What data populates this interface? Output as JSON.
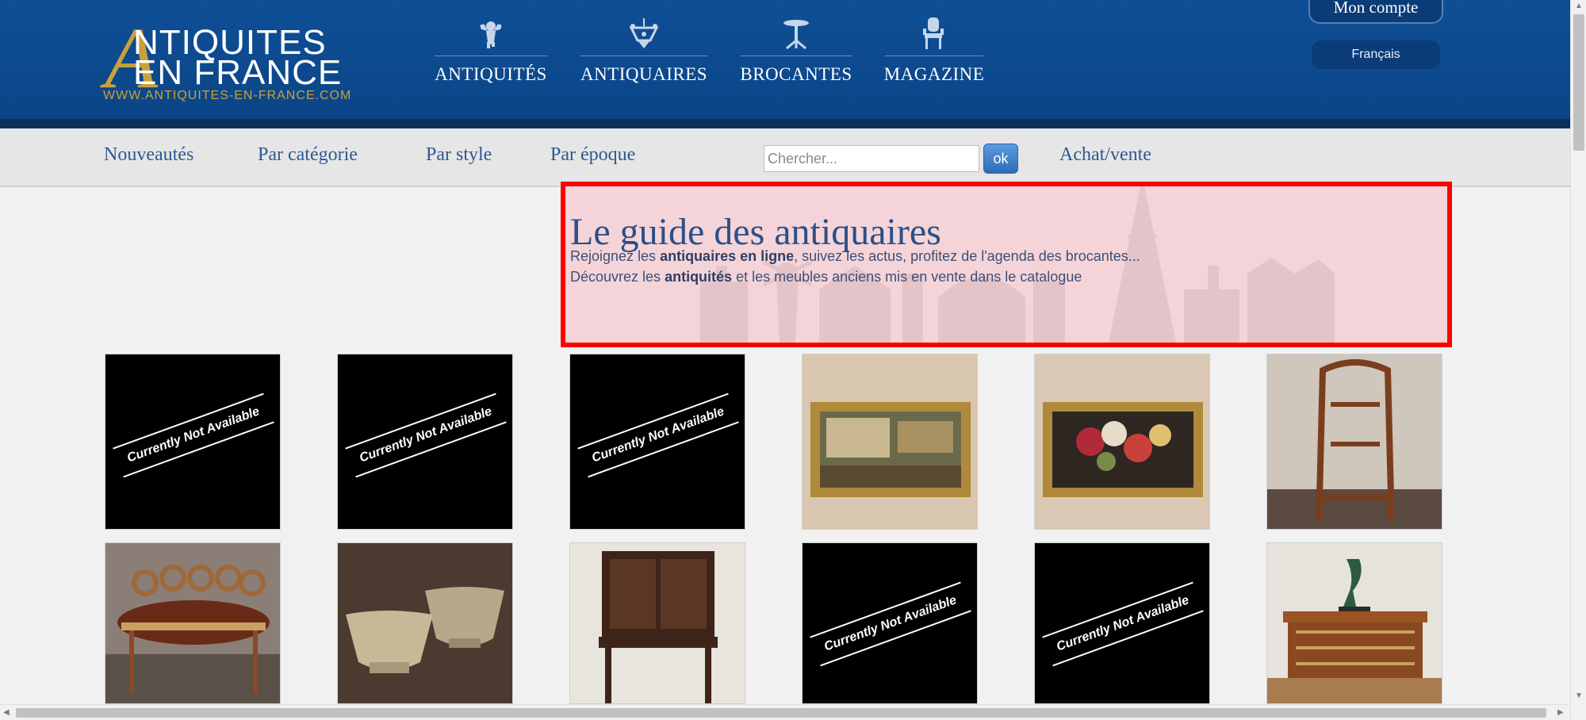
{
  "logo": {
    "letter": "A",
    "line1": "NTIQUITES",
    "line2": "EN FRANCE",
    "url": "WWW.ANTIQUITES-EN-FRANCE.COM"
  },
  "main_nav": [
    {
      "label": "ANTIQUITÉS",
      "icon": "cherub-icon"
    },
    {
      "label": "ANTIQUAIRES",
      "icon": "chandelier-icon"
    },
    {
      "label": "BROCANTES",
      "icon": "table-icon"
    },
    {
      "label": "MAGAZINE",
      "icon": "chair-icon"
    }
  ],
  "account": {
    "label": "Mon compte"
  },
  "language": {
    "label": "Français"
  },
  "subnav": {
    "links": [
      "Nouveautés",
      "Par catégorie",
      "Par style",
      "Par époque"
    ],
    "search_placeholder": "Chercher...",
    "ok_label": "ok",
    "achat_label": "Achat/vente"
  },
  "hero": {
    "title": "Le guide des antiquaires",
    "line1": {
      "pre": "Rejoignez les ",
      "bold": "antiquaires en ligne",
      "post": ", suivez les actus, profitez de l'agenda des brocantes..."
    },
    "line2": {
      "pre": "Découvrez les ",
      "bold": "antiquités",
      "post": " et les meubles anciens mis en vente dans le catalogue"
    }
  },
  "grid": {
    "not_available_text": "Currently Not Available",
    "items": [
      {
        "kind": "na"
      },
      {
        "kind": "na"
      },
      {
        "kind": "na"
      },
      {
        "kind": "painting-village"
      },
      {
        "kind": "painting-flowers"
      },
      {
        "kind": "vitrine"
      },
      {
        "kind": "round-table"
      },
      {
        "kind": "stone-bowls"
      },
      {
        "kind": "cabinet"
      },
      {
        "kind": "na"
      },
      {
        "kind": "na"
      },
      {
        "kind": "commode-statue"
      }
    ]
  },
  "colors": {
    "header_blue": "#0f4f96",
    "gold": "#c9a13a",
    "link_blue": "#2c5994",
    "hero_border": "#ff0000"
  }
}
